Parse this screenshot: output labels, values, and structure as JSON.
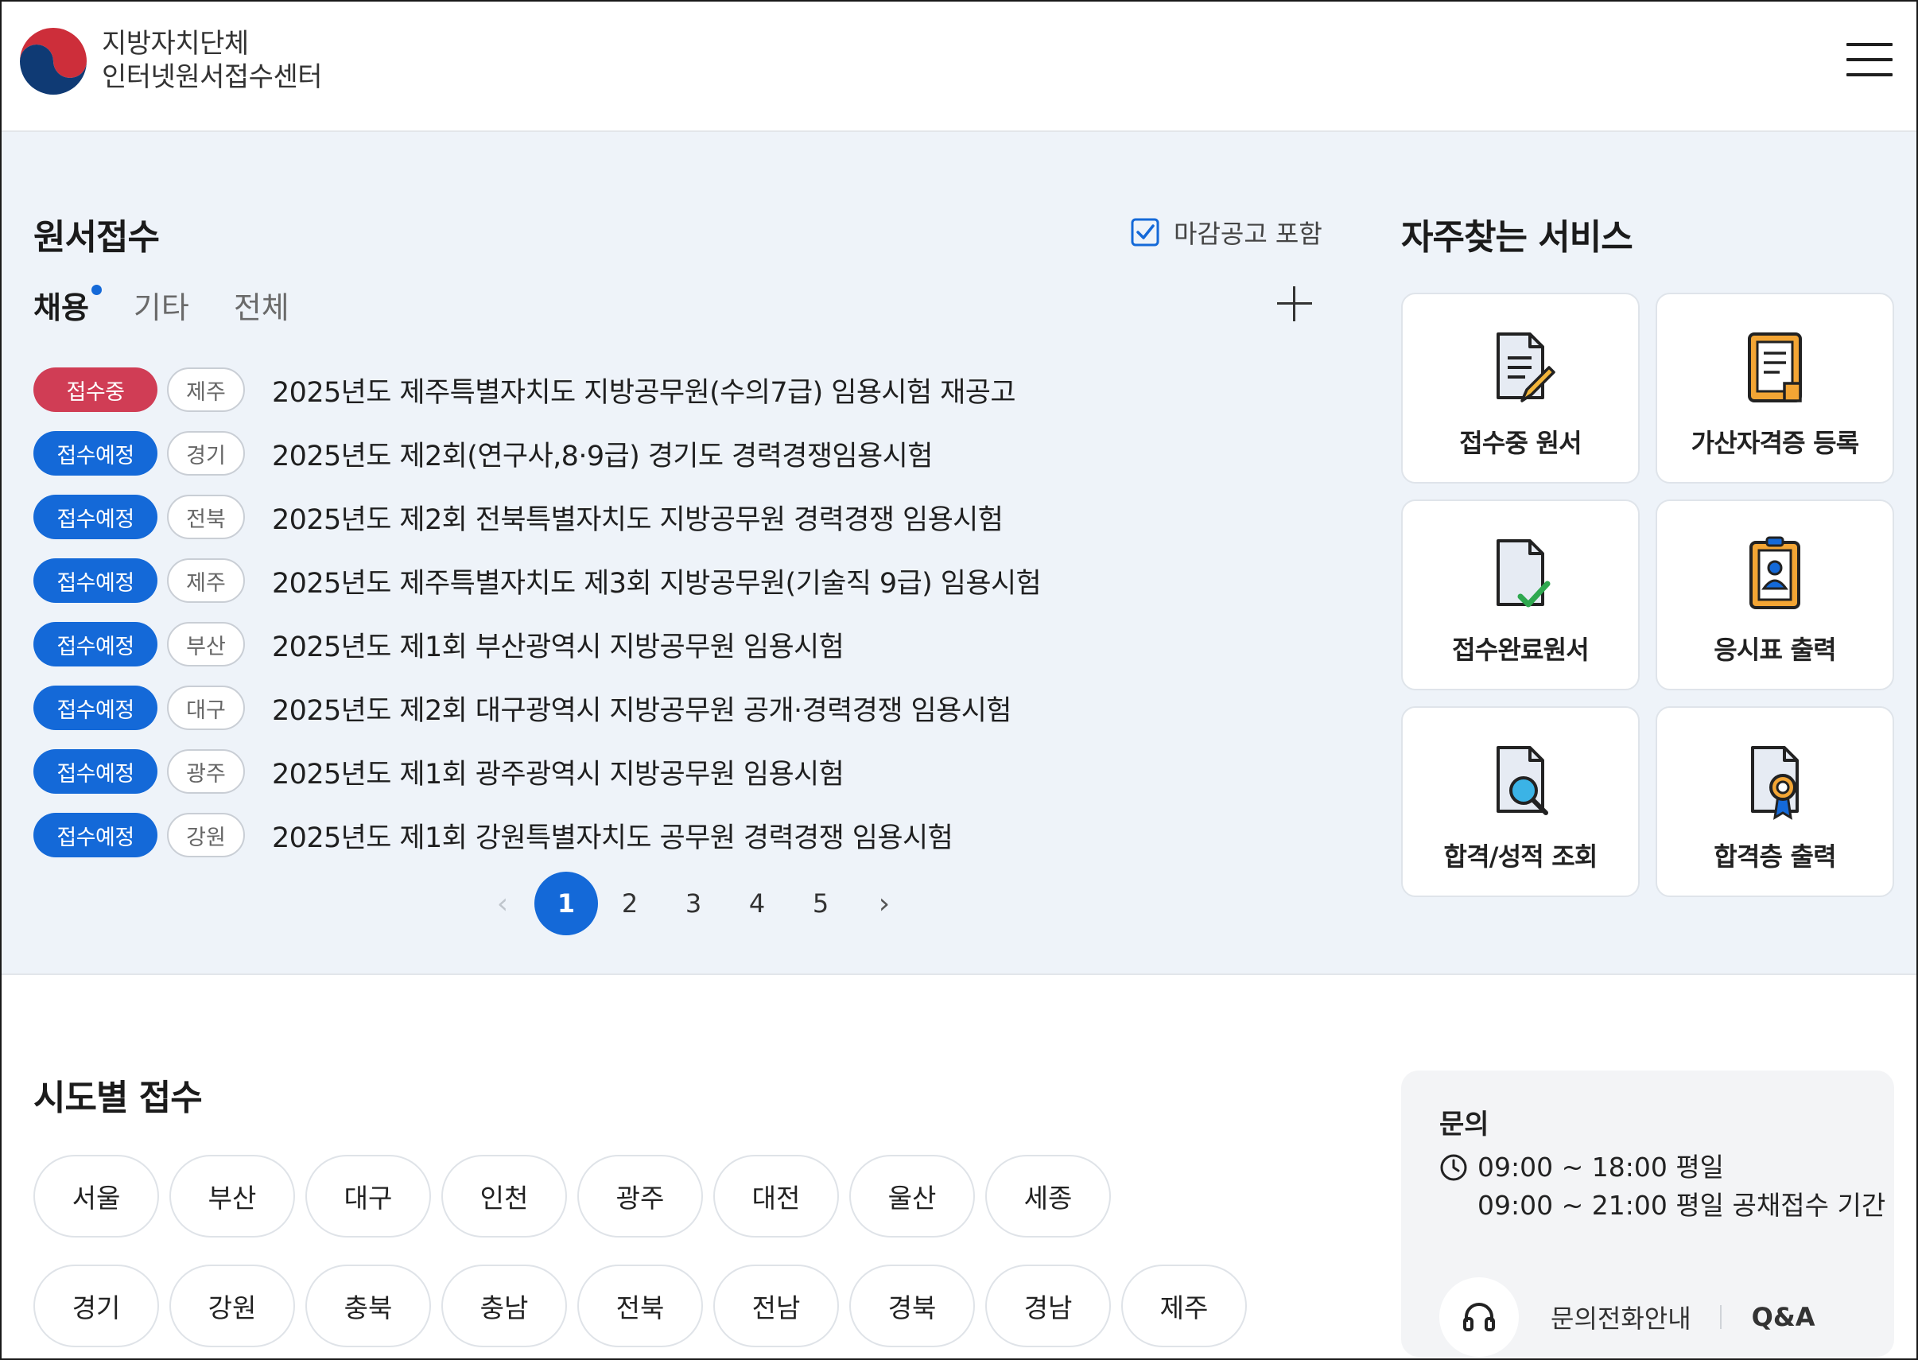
{
  "header": {
    "brand_line1": "지방자치단체",
    "brand_line2": "인터넷원서접수센터"
  },
  "application": {
    "title": "원서접수",
    "include_closed_label": "마감공고 포함",
    "include_closed_checked": true,
    "tabs": [
      {
        "label": "채용",
        "active": true
      },
      {
        "label": "기타",
        "active": false
      },
      {
        "label": "전체",
        "active": false
      }
    ],
    "items": [
      {
        "status": "접수중",
        "region": "제주",
        "title": "2025년도 제주특별자치도 지방공무원(수의7급) 임용시험 재공고"
      },
      {
        "status": "접수예정",
        "region": "경기",
        "title": "2025년도 제2회(연구사,8·9급) 경기도 경력경쟁임용시험"
      },
      {
        "status": "접수예정",
        "region": "전북",
        "title": "2025년도 제2회 전북특별자치도 지방공무원 경력경쟁 임용시험"
      },
      {
        "status": "접수예정",
        "region": "제주",
        "title": "2025년도 제주특별자치도 제3회 지방공무원(기술직 9급) 임용시험"
      },
      {
        "status": "접수예정",
        "region": "부산",
        "title": "2025년도 제1회 부산광역시 지방공무원 임용시험"
      },
      {
        "status": "접수예정",
        "region": "대구",
        "title": "2025년도 제2회 대구광역시 지방공무원 공개·경력경쟁 임용시험"
      },
      {
        "status": "접수예정",
        "region": "광주",
        "title": "2025년도 제1회 광주광역시 지방공무원 임용시험"
      },
      {
        "status": "접수예정",
        "region": "강원",
        "title": "2025년도 제1회 강원특별자치도 공무원 경력경쟁 임용시험"
      }
    ],
    "pages": [
      "1",
      "2",
      "3",
      "4",
      "5"
    ],
    "current_page": "1"
  },
  "services": {
    "title": "자주찾는 서비스",
    "items": [
      {
        "label": "접수중 원서",
        "icon": "document-pen-icon"
      },
      {
        "label": "가산자격증 등록",
        "icon": "certificate-doc-icon"
      },
      {
        "label": "접수완료원서",
        "icon": "document-check-icon"
      },
      {
        "label": "응시표 출력",
        "icon": "id-card-icon"
      },
      {
        "label": "합격/성적 조회",
        "icon": "document-search-icon"
      },
      {
        "label": "합격층 출력",
        "icon": "document-award-icon"
      }
    ]
  },
  "regions": {
    "title": "시도별 접수",
    "row1": [
      "서울",
      "부산",
      "대구",
      "인천",
      "광주",
      "대전",
      "울산",
      "세종"
    ],
    "row2": [
      "경기",
      "강원",
      "충북",
      "충남",
      "전북",
      "전남",
      "경북",
      "경남",
      "제주"
    ]
  },
  "inquiry": {
    "title": "문의",
    "hours1": "09:00 ~ 18:00 평일",
    "hours2": "09:00 ~ 21:00 평일 공채접수 기간",
    "phone_label": "문의전화안내",
    "qa_label": "Q&A"
  },
  "colors": {
    "accent": "#1469d8",
    "ongoing": "#d03d55",
    "section_bg": "#eef3f9"
  }
}
